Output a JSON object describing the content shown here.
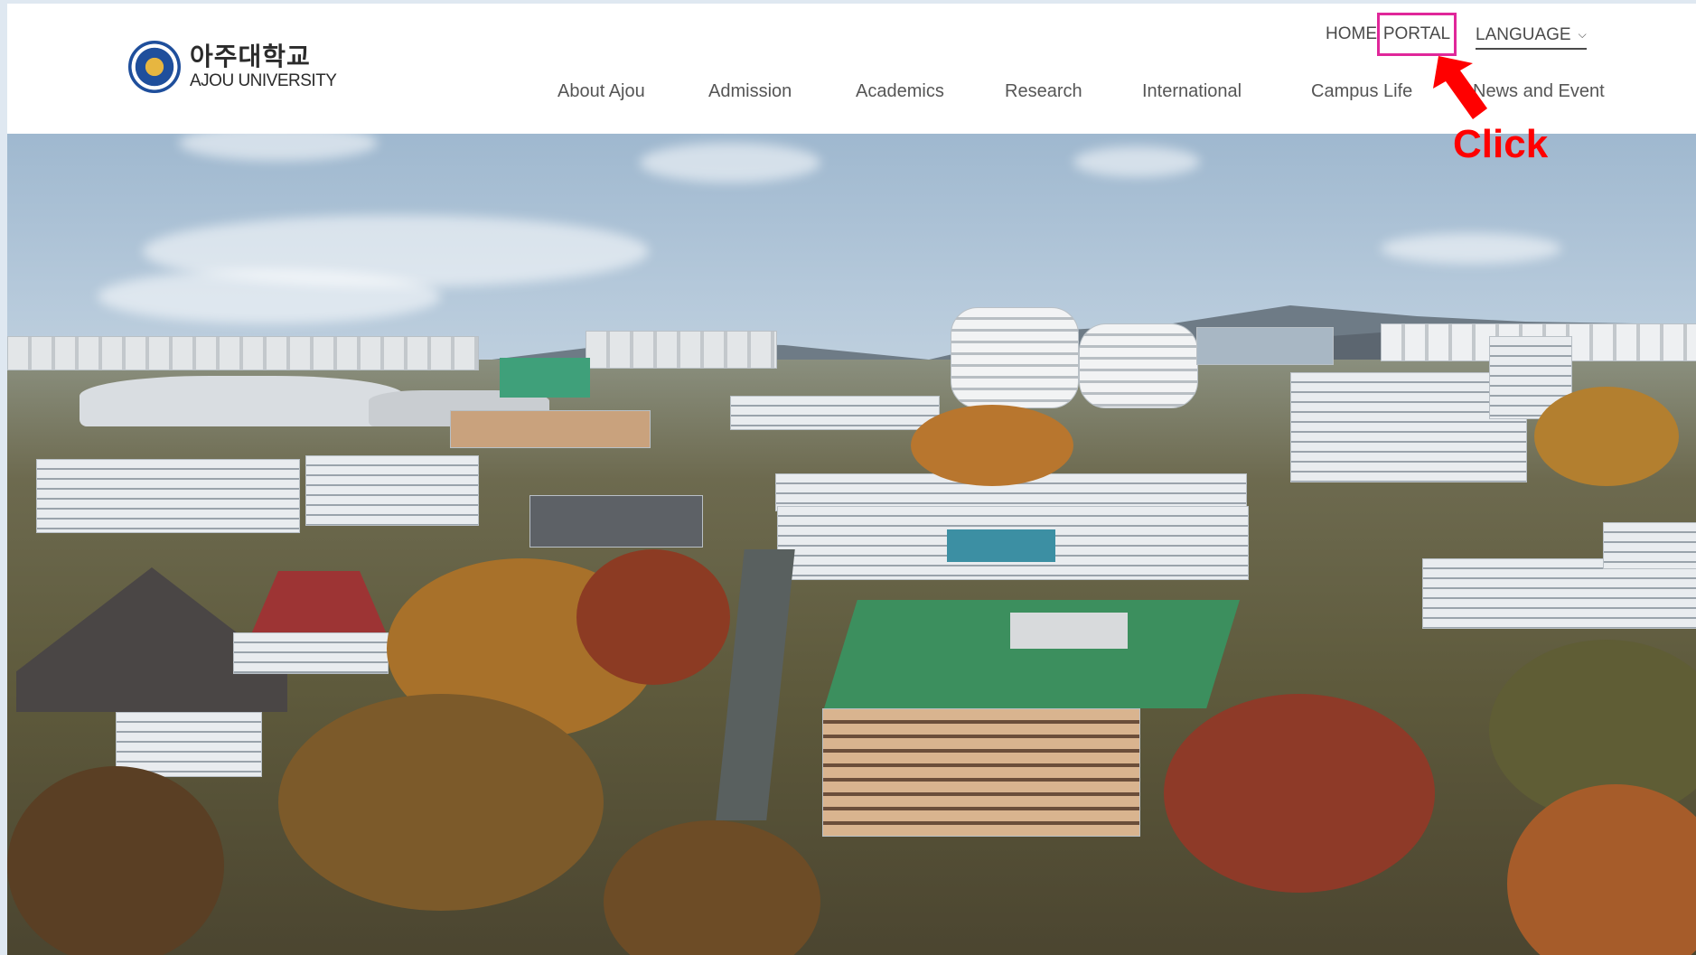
{
  "logo": {
    "korean_name": "아주대학교",
    "english_name": "AJOU UNIVERSITY"
  },
  "utility_nav": {
    "home": "HOME",
    "portal": "PORTAL",
    "language": "LANGUAGE"
  },
  "main_nav": [
    {
      "label": "About Ajou"
    },
    {
      "label": "Admission"
    },
    {
      "label": "Academics"
    },
    {
      "label": "Research"
    },
    {
      "label": "International"
    },
    {
      "label": "Campus Life"
    },
    {
      "label": "News and Event"
    }
  ],
  "annotation": {
    "label": "Click",
    "highlight_color": "#e0279a",
    "arrow_color": "#ff0000"
  },
  "hero": {
    "icon": "campus-aerial-photo"
  }
}
